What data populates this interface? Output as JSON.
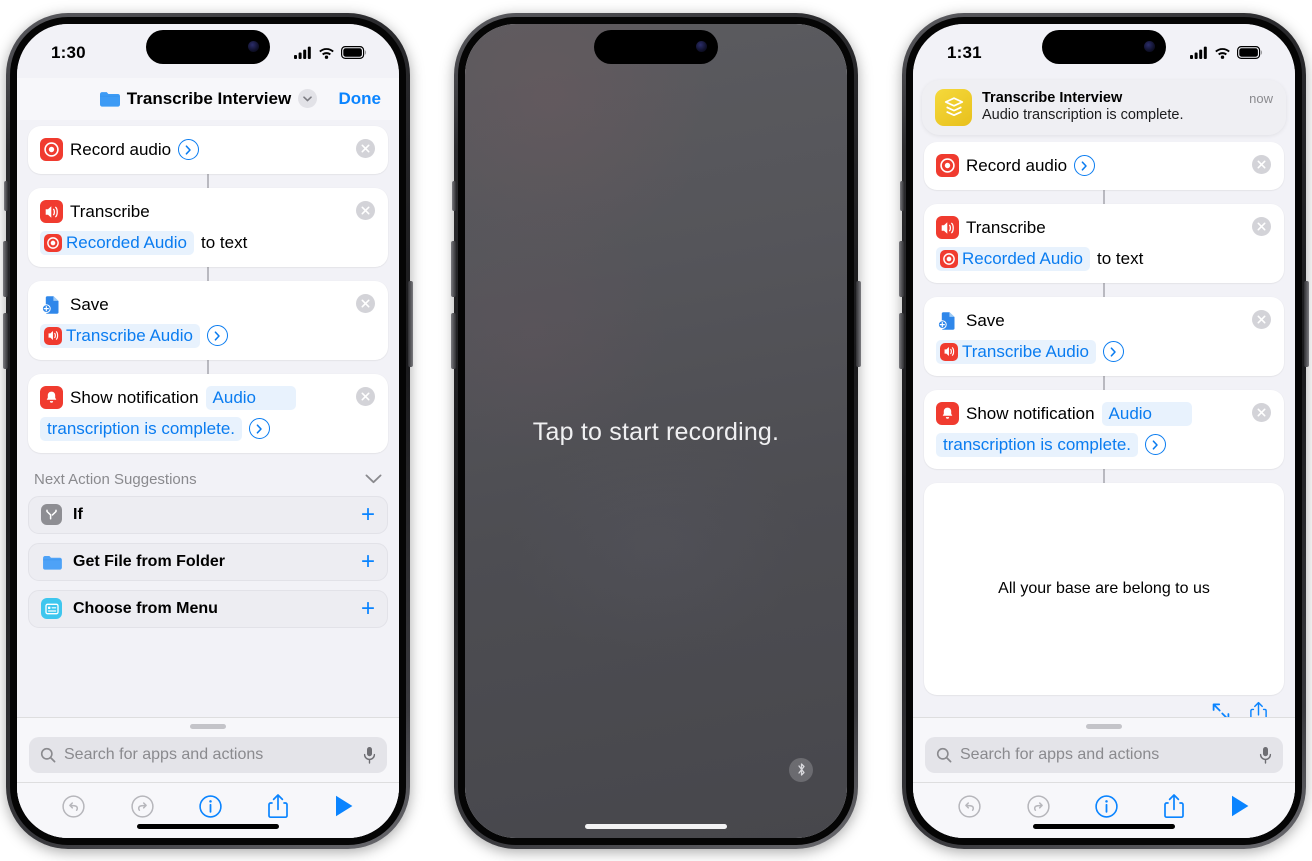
{
  "phones": [
    {
      "id": "phone-editor",
      "status_bar": {
        "time": "1:30",
        "cellular": "signal-bars-icon",
        "wifi": "wifi-icon",
        "battery": "battery-icon"
      },
      "nav": {
        "folder_icon": "folder-icon",
        "title": "Transcribe Interview",
        "chevron": "chevron-down-icon",
        "done_label": "Done"
      },
      "actions": [
        {
          "icon": "record-audio-icon",
          "lines": [
            {
              "parts": [
                {
                  "type": "text",
                  "value": "Record audio"
                },
                {
                  "type": "disclosure",
                  "value": "disclosure-chevron-icon"
                }
              ]
            }
          ],
          "remove": "remove-action-icon"
        },
        {
          "icon": "transcribe-audio-icon",
          "lines": [
            {
              "parts": [
                {
                  "type": "text",
                  "value": "Transcribe"
                }
              ]
            },
            {
              "parts": [
                {
                  "type": "token-icon",
                  "value": "Recorded Audio",
                  "icon": "record-audio-icon"
                },
                {
                  "type": "text",
                  "value": "to text"
                }
              ]
            }
          ],
          "remove": "remove-action-icon"
        },
        {
          "icon": "save-file-icon",
          "lines": [
            {
              "parts": [
                {
                  "type": "text",
                  "value": "Save"
                }
              ]
            },
            {
              "parts": [
                {
                  "type": "token-icon",
                  "value": "Transcribe Audio",
                  "icon": "transcribe-audio-icon"
                },
                {
                  "type": "disclosure",
                  "value": "disclosure-chevron-icon"
                }
              ]
            }
          ],
          "remove": "remove-action-icon"
        },
        {
          "icon": "show-notification-icon",
          "lines": [
            {
              "parts": [
                {
                  "type": "text",
                  "value": "Show notification"
                },
                {
                  "type": "token",
                  "value": "Audio"
                }
              ]
            },
            {
              "parts": [
                {
                  "type": "token",
                  "value": "transcription is complete."
                },
                {
                  "type": "disclosure",
                  "value": "disclosure-chevron-icon"
                }
              ]
            }
          ],
          "remove": "remove-action-icon"
        }
      ],
      "suggestions": {
        "title": "Next Action Suggestions",
        "collapse_icon": "chevron-down-icon",
        "items": [
          {
            "icon": "if-condition-icon",
            "label": "If",
            "add": "plus-icon"
          },
          {
            "icon": "folder-icon",
            "label": "Get File from Folder",
            "add": "plus-icon"
          },
          {
            "icon": "menu-icon",
            "label": "Choose from Menu",
            "add": "plus-icon"
          }
        ]
      },
      "search": {
        "icon": "search-icon",
        "placeholder": "Search for apps and actions",
        "mic": "microphone-icon"
      },
      "toolbar": [
        {
          "name": "undo-button",
          "icon": "undo-icon",
          "enabled": false
        },
        {
          "name": "redo-button",
          "icon": "redo-icon",
          "enabled": false
        },
        {
          "name": "info-button",
          "icon": "info-icon",
          "enabled": true
        },
        {
          "name": "share-button",
          "icon": "share-icon",
          "enabled": true
        },
        {
          "name": "run-button",
          "icon": "play-icon",
          "enabled": true
        }
      ]
    },
    {
      "id": "phone-recording",
      "prompt": "Tap to start recording.",
      "bluetooth_badge": "bluetooth-icon"
    },
    {
      "id": "phone-result",
      "status_bar": {
        "time": "1:31",
        "cellular": "signal-bars-icon",
        "wifi": "wifi-icon",
        "battery": "battery-icon"
      },
      "notification": {
        "app_icon": "shortcuts-app-icon",
        "title": "Transcribe Interview",
        "subtitle": "Audio transcription is complete.",
        "time": "now"
      },
      "actions": [
        {
          "icon": "record-audio-icon",
          "lines": [
            {
              "parts": [
                {
                  "type": "text",
                  "value": "Record audio"
                },
                {
                  "type": "disclosure",
                  "value": "disclosure-chevron-icon"
                }
              ]
            }
          ],
          "remove": "remove-action-icon"
        },
        {
          "icon": "transcribe-audio-icon",
          "lines": [
            {
              "parts": [
                {
                  "type": "text",
                  "value": "Transcribe"
                }
              ]
            },
            {
              "parts": [
                {
                  "type": "token-icon",
                  "value": "Recorded Audio",
                  "icon": "record-audio-icon"
                },
                {
                  "type": "text",
                  "value": "to text"
                }
              ]
            }
          ],
          "remove": "remove-action-icon"
        },
        {
          "icon": "save-file-icon",
          "lines": [
            {
              "parts": [
                {
                  "type": "text",
                  "value": "Save"
                }
              ]
            },
            {
              "parts": [
                {
                  "type": "token-icon",
                  "value": "Transcribe Audio",
                  "icon": "transcribe-audio-icon"
                },
                {
                  "type": "disclosure",
                  "value": "disclosure-chevron-icon"
                }
              ]
            }
          ],
          "remove": "remove-action-icon"
        },
        {
          "icon": "show-notification-icon",
          "lines": [
            {
              "parts": [
                {
                  "type": "text",
                  "value": "Show notification"
                },
                {
                  "type": "token",
                  "value": "Audio"
                }
              ]
            },
            {
              "parts": [
                {
                  "type": "token",
                  "value": "transcription is complete."
                },
                {
                  "type": "disclosure",
                  "value": "disclosure-chevron-icon"
                }
              ]
            }
          ],
          "remove": "remove-action-icon"
        }
      ],
      "result": {
        "text": "All your base are belong to us",
        "expand_icon": "expand-diagonal-icon",
        "share_icon": "share-icon"
      },
      "search": {
        "icon": "search-icon",
        "placeholder": "Search for apps and actions",
        "mic": "microphone-icon"
      },
      "toolbar": [
        {
          "name": "undo-button",
          "icon": "undo-icon",
          "enabled": false
        },
        {
          "name": "redo-button",
          "icon": "redo-icon",
          "enabled": false
        },
        {
          "name": "info-button",
          "icon": "info-icon",
          "enabled": true
        },
        {
          "name": "share-button",
          "icon": "share-icon",
          "enabled": true
        },
        {
          "name": "run-button",
          "icon": "play-icon",
          "enabled": true
        }
      ]
    }
  ],
  "colors": {
    "accent_blue": "#0a84ff",
    "token_blue": "#0a7cf0",
    "token_bg": "#e8f2fd",
    "action_red": "#f03b2f",
    "shortcuts_yellow": "#f0cc22",
    "screen_bg": "#f2f2f7",
    "recording_bg": "#4f4f54"
  }
}
